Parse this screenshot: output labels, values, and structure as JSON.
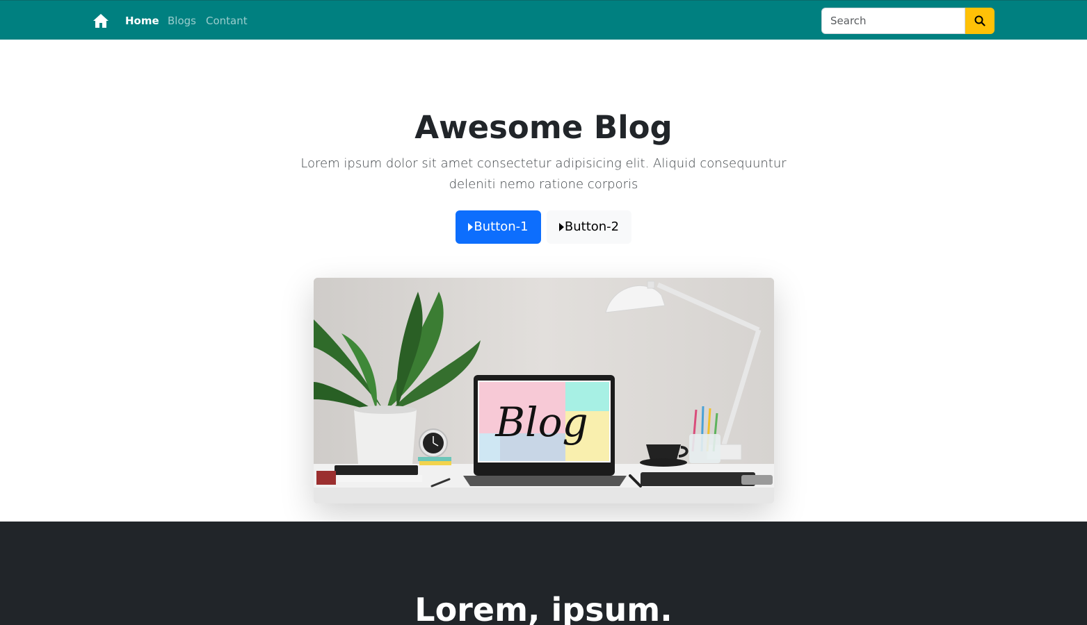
{
  "navbar": {
    "home_icon": "home-icon",
    "links": [
      {
        "label": "Home",
        "active": true
      },
      {
        "label": "Blogs",
        "active": false
      },
      {
        "label": "Contant",
        "active": false
      }
    ],
    "search": {
      "placeholder": "Search",
      "button_icon": "search-icon"
    },
    "colors": {
      "background": "#008080",
      "search_button": "#ffc107"
    }
  },
  "hero": {
    "title": "Awesome Blog",
    "text": "Lorem ipsum dolor sit amet consectetur adipisicing elit. Aliquid consequuntur deleniti nemo ratione corporis",
    "buttons": [
      {
        "label": "Button-1",
        "icon": "play-icon",
        "color": "#0d6efd"
      },
      {
        "label": "Button-2",
        "icon": "play-icon",
        "color": "#f8f9fa"
      }
    ],
    "image": {
      "screen_text": "Blog"
    }
  },
  "section2": {
    "title": "Lorem, ipsum.",
    "background": "#212529"
  }
}
